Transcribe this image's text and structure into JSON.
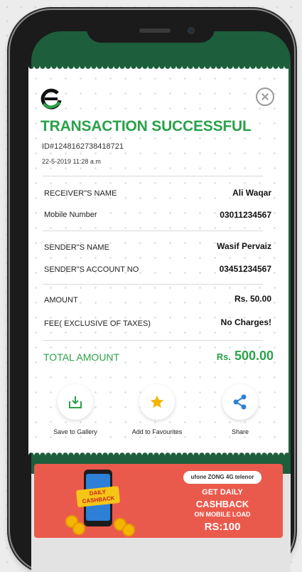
{
  "header": {
    "title": "TRANSACTION SUCCESSFUL",
    "transaction_id": "ID#1248162738418721",
    "datetime": "22-5-2019 11:28 a.m"
  },
  "details": [
    {
      "label": "RECEIVER\"S NAME",
      "value": "Ali Waqar"
    },
    {
      "label": "Mobile Number",
      "value": "03011234567"
    },
    {
      "label": "SENDER\"S NAME",
      "value": "Wasif Pervaiz"
    },
    {
      "label": "SENDER\"S ACCOUNT NO",
      "value": "03451234567"
    },
    {
      "label": "AMOUNT",
      "value": "Rs. 50.00"
    },
    {
      "label": "FEE( EXCLUSIVE OF TAXES)",
      "value": "No Charges!"
    }
  ],
  "total": {
    "label": "TOTAL AMOUNT",
    "currency": "Rs.",
    "amount": "500.00"
  },
  "actions": [
    {
      "label": "Save to Gallery",
      "icon": "download-icon"
    },
    {
      "label": "Add to Favourites",
      "icon": "star-icon"
    },
    {
      "label": "Share",
      "icon": "share-icon"
    }
  ],
  "banner": {
    "badge": "DAILY CASHBACK",
    "networks": "ufone ZONG 4G telenor",
    "line1": "GET DAILY",
    "line2": "CASHBACK",
    "line3": "ON MOBILE LOAD",
    "line4": "RS:100"
  },
  "colors": {
    "accent_green": "#2aa24a",
    "screen_green": "#1d5e3c",
    "banner_red": "#ea5a4c",
    "star_gold": "#f5b400",
    "share_blue": "#2f7fd8"
  }
}
